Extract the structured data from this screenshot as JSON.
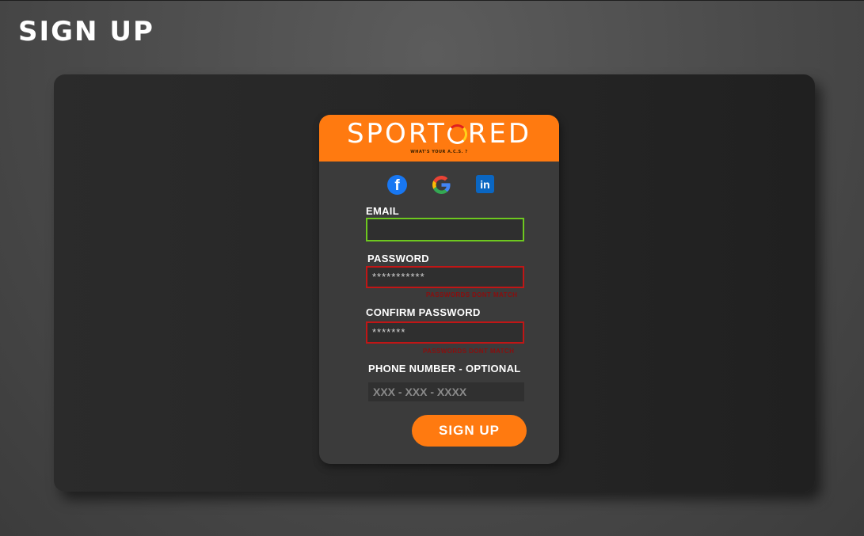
{
  "page": {
    "title": "SIGN UP"
  },
  "brand": {
    "logo_before": "SPORT",
    "logo_after": "RED",
    "tagline": "WHAT'S YOUR A.C.S. ?",
    "accent_color": "#ff7a10"
  },
  "social": {
    "facebook": {
      "icon": "facebook-icon",
      "glyph": "f"
    },
    "google": {
      "icon": "google-icon"
    },
    "linkedin": {
      "icon": "linkedin-icon",
      "glyph": "in"
    }
  },
  "form": {
    "email": {
      "label": "EMAIL",
      "value": ""
    },
    "password": {
      "label": "PASSWORD",
      "value": "***********",
      "error": "PASSWORDS DONT MATCH",
      "border_color": "#c01616"
    },
    "confirm_password": {
      "label": "CONFIRM PASSWORD",
      "value": "*******",
      "error": "PASSWORDS DONT MATCH",
      "border_color": "#c01616"
    },
    "phone": {
      "label": "PHONE NUMBER - OPTIONAL",
      "placeholder": "XXX - XXX - XXXX"
    },
    "submit_label": "SIGN UP"
  },
  "colors": {
    "valid_border": "#6dc81f",
    "error_border": "#c01616",
    "error_text": "#8a0e0e"
  }
}
